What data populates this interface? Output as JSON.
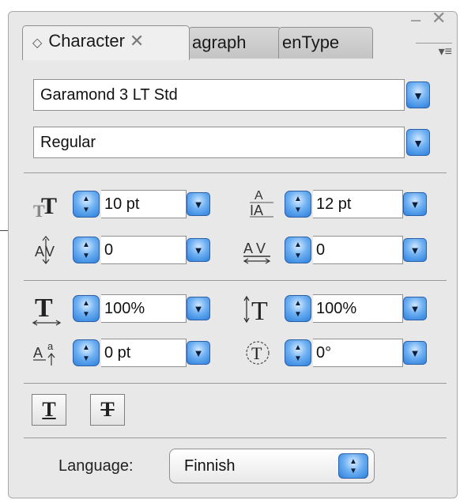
{
  "window": {
    "minimize_glyph": "–",
    "close_glyph": "✕",
    "panel_menu_glyph": "▾≡"
  },
  "tabs": [
    {
      "label": "Character",
      "active": true,
      "close_glyph": "✕",
      "reorder_glyph": "◇"
    },
    {
      "label": "agraph",
      "active": false
    },
    {
      "label": "enType",
      "active": false
    }
  ],
  "font": {
    "family": "Garamond 3 LT Std",
    "style": "Regular"
  },
  "controls": {
    "font_size": "10 pt",
    "leading": "12 pt",
    "kerning": "0",
    "tracking": "0",
    "vertical_scale": "100%",
    "horizontal_scale": "100%",
    "baseline_shift": "0 pt",
    "character_rotation": "0°"
  },
  "style_buttons": {
    "underline_glyph": "T",
    "strikethrough_glyph": "T"
  },
  "language": {
    "label": "Language:",
    "value": "Finnish"
  },
  "icons": {
    "font_size": "font-size-icon",
    "leading": "leading-icon",
    "kerning": "kerning-icon",
    "tracking": "tracking-icon",
    "vertical_scale": "vertical-scale-icon",
    "horizontal_scale": "horizontal-scale-icon",
    "baseline_shift": "baseline-shift-icon",
    "character_rotation": "character-rotation-icon"
  },
  "colors": {
    "accent": "#2c7fdc",
    "panel_bg": "#e8e8e8"
  }
}
